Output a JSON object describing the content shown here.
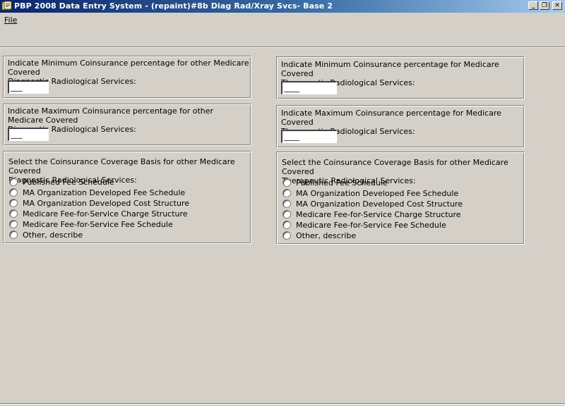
{
  "window": {
    "title": "PBP 2008 Data Entry System - (repaint)#8b Diag Rad/Xray Svcs- Base 2",
    "minimize_glyph": "_",
    "maximize_glyph": "❐",
    "close_glyph": "✕"
  },
  "menu": {
    "file_label": "File"
  },
  "diagnostic": {
    "min_coins": {
      "label": "Indicate Minimum Coinsurance percentage for other Medicare Covered\nDiagnostic Radiological Services:",
      "value": "___"
    },
    "max_coins": {
      "label": "Indicate Maximum Coinsurance percentage for other Medicare Covered\nDiagnostic Radiological Services:",
      "value": "___"
    },
    "basis": {
      "label": "Select the Coinsurance Coverage Basis for other Medicare Covered\nDiagnostic Radiological Services:",
      "options": [
        "Published Fee Schedule",
        "MA Organization Developed Fee Schedule",
        "MA Organization Developed Cost Structure",
        "Medicare Fee-for-Service Charge Structure",
        "Medicare Fee-for-Service Fee Schedule",
        "Other, describe"
      ]
    }
  },
  "therapeutic": {
    "min_coins": {
      "label": "Indicate Minimum Coinsurance percentage for Medicare Covered\nTherapeutic Radiological Services:",
      "value": "____"
    },
    "max_coins": {
      "label": "Indicate Maximum Coinsurance percentage for Medicare Covered\nTherapeutic Radiological Services:",
      "value": "____"
    },
    "basis": {
      "label": "Select the Coinsurance Coverage Basis for other Medicare Covered\nTherapeutic Radiological Services:",
      "options": [
        "Published Fee Schedule",
        "MA Organization Developed Fee Schedule",
        "MA Organization Developed Cost Structure",
        "Medicare Fee-for-Service Charge Structure",
        "Medicare Fee-for-Service Fee Schedule",
        "Other, describe"
      ]
    }
  }
}
